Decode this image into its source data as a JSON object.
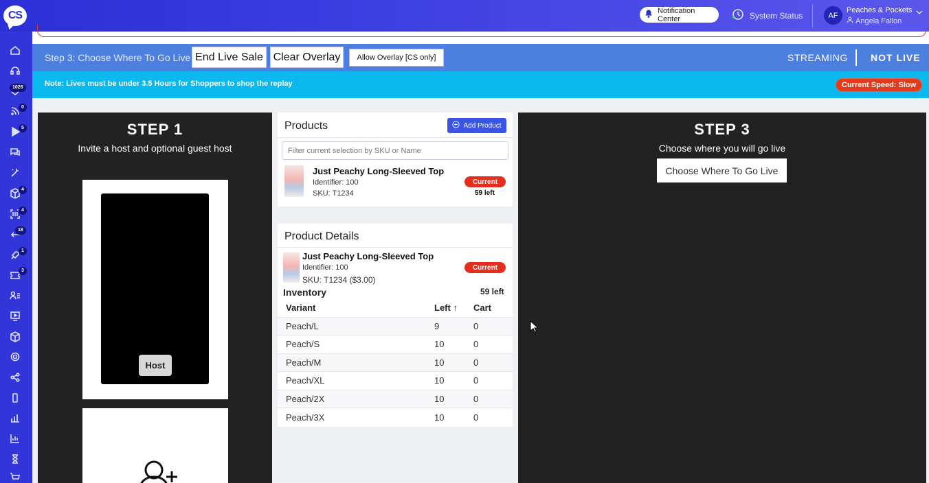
{
  "topbar": {
    "logo_text": "CS",
    "notification_label": "Notification Center",
    "system_status_label": "System Status",
    "avatar_initials": "AF",
    "account_name": "Peaches & Pockets",
    "account_user": "Angela Fallon"
  },
  "sidebar": {
    "badges": {
      "orders": "1026",
      "feeds": "0",
      "live": "5",
      "products": "4",
      "scan": "4",
      "returns": "18",
      "promos": "1",
      "tickets": "3"
    }
  },
  "stepbar": {
    "label": "Step 3: Choose Where To Go Live",
    "end_live_sale": "End Live Sale",
    "clear_overlay": "Clear Overlay",
    "allow_overlay": "Allow Overlay [CS only]",
    "streaming": "STREAMING",
    "status": "NOT LIVE"
  },
  "notebar": {
    "note": "Note: Lives must be under 3.5 Hours for Shoppers to shop the replay",
    "speed": "Current Speed: Slow"
  },
  "step1": {
    "title": "STEP 1",
    "subtitle": "Invite a host and optional guest host",
    "host_label": "Host"
  },
  "products": {
    "title": "Products",
    "add_button": "Add Product",
    "filter_placeholder": "Filter current selection by SKU or Name",
    "item": {
      "name": "Just Peachy Long-Sleeved Top",
      "identifier": "Identifier: 100",
      "sku": "SKU: T1234",
      "badge": "Current",
      "left": "59 left"
    }
  },
  "details": {
    "title": "Product Details",
    "name": "Just Peachy Long-Sleeved Top",
    "identifier": "Identifier: 100",
    "sku": "SKU: T1234 ($3.00)",
    "badge": "Current",
    "inventory_label": "Inventory",
    "inventory_left": "59 left",
    "columns": [
      "Variant",
      "Left",
      "Cart"
    ],
    "sort_indicator": "↑",
    "rows": [
      [
        "Peach/L",
        "9",
        "0"
      ],
      [
        "Peach/S",
        "10",
        "0"
      ],
      [
        "Peach/M",
        "10",
        "0"
      ],
      [
        "Peach/XL",
        "10",
        "0"
      ],
      [
        "Peach/2X",
        "10",
        "0"
      ],
      [
        "Peach/3X",
        "10",
        "0"
      ]
    ]
  },
  "step3": {
    "title": "STEP 3",
    "subtitle": "Choose where you will go live",
    "button": "Choose Where To Go Live"
  }
}
